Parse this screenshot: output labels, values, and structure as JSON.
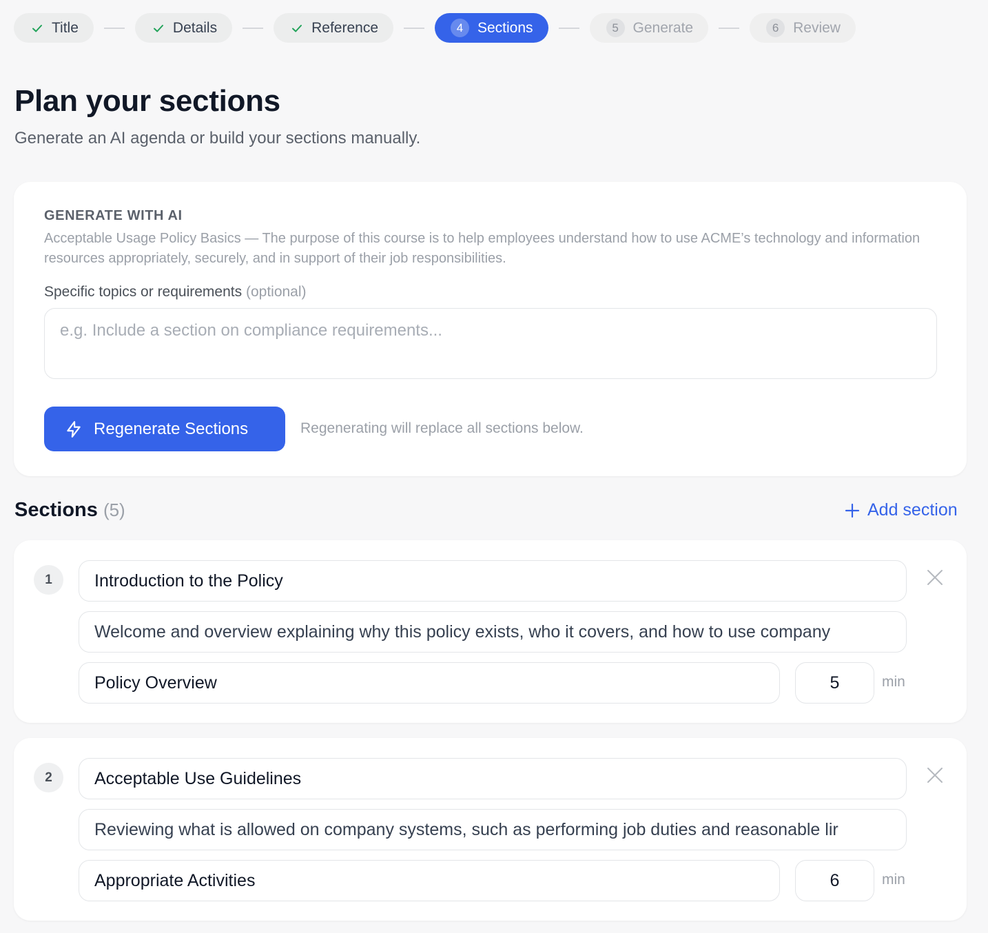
{
  "stepper": {
    "steps": [
      {
        "label": "Title",
        "state": "done"
      },
      {
        "label": "Details",
        "state": "done"
      },
      {
        "label": "Reference",
        "state": "done"
      },
      {
        "label": "Sections",
        "num": "4",
        "state": "active"
      },
      {
        "label": "Generate",
        "num": "5",
        "state": "pending"
      },
      {
        "label": "Review",
        "num": "6",
        "state": "pending"
      }
    ]
  },
  "header": {
    "title": "Plan your sections",
    "subtitle": "Generate an AI agenda or build your sections manually."
  },
  "ai_panel": {
    "label": "GENERATE WITH AI",
    "description": "Acceptable Usage Policy Basics — The purpose of this course is to help employees understand how to use ACME’s technology and information resources appropriately, securely, and in support of their job responsibilities.",
    "topics_label": "Specific topics or requirements",
    "topics_optional": "(optional)",
    "topics_value": "",
    "topics_placeholder": "e.g. Include a section on compliance requirements...",
    "regen_label": "Regenerate Sections",
    "regen_note": "Regenerating will replace all sections below."
  },
  "sections_header": {
    "title": "Sections",
    "count": "(5)",
    "add_label": "Add section"
  },
  "sections": [
    {
      "num": "1",
      "title": "Introduction to the Policy",
      "description": "Welcome and overview explaining why this policy exists, who it covers, and how to use company",
      "tag": "Policy Overview",
      "minutes": "5",
      "min_label": "min"
    },
    {
      "num": "2",
      "title": "Acceptable Use Guidelines",
      "description": "Reviewing what is allowed on company systems, such as performing job duties and reasonable lir",
      "tag": "Appropriate Activities",
      "minutes": "6",
      "min_label": "min"
    }
  ],
  "colors": {
    "accent": "#3563e9",
    "check": "#22a35a",
    "background": "#f7f7f8"
  },
  "icons": {
    "step_done": "check-icon",
    "regen": "lightning-icon",
    "add": "plus-icon",
    "remove": "close-icon"
  }
}
